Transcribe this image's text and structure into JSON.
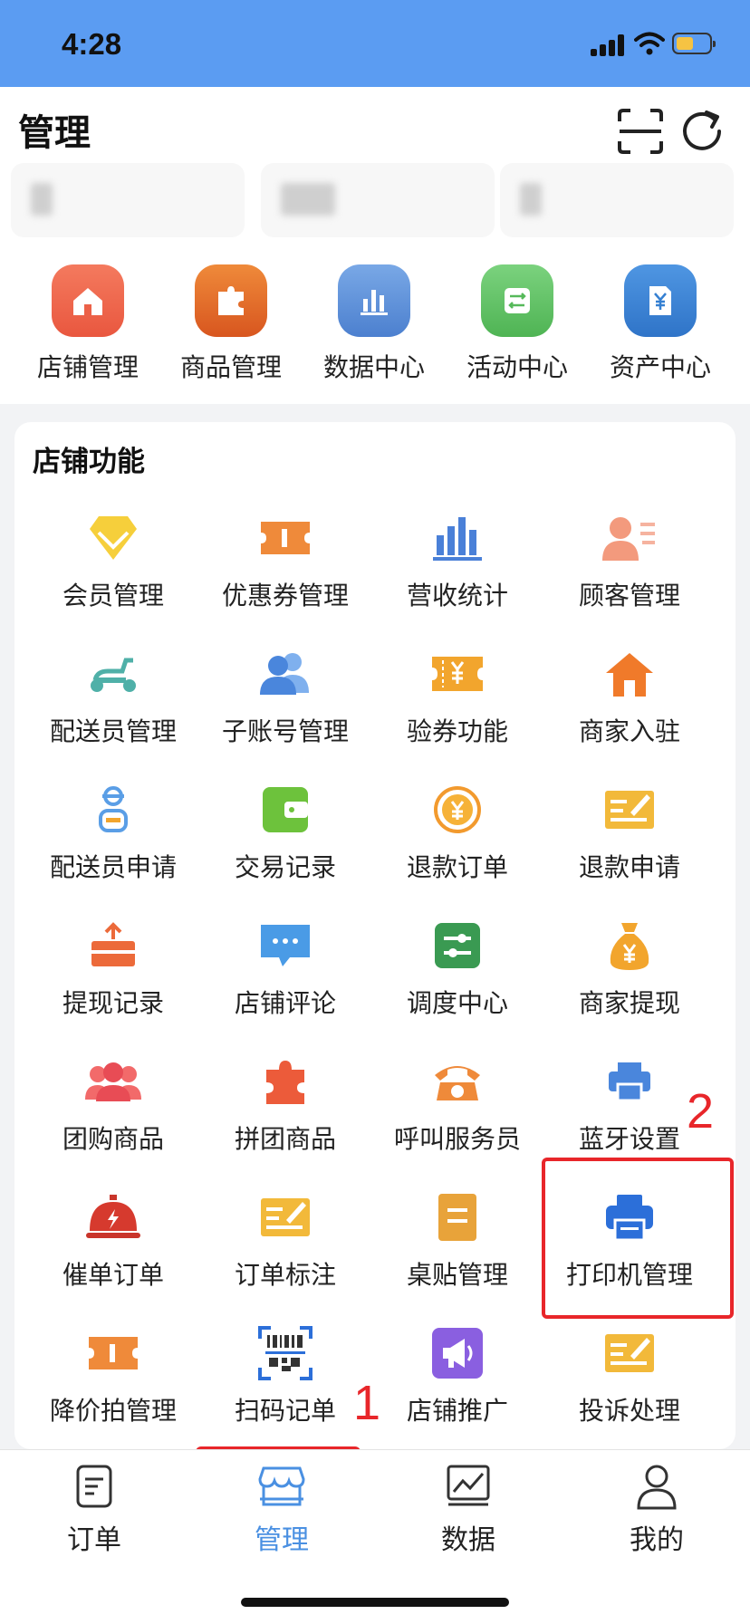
{
  "status_bar": {
    "time": "4:28"
  },
  "header": {
    "title": "管理"
  },
  "quick_menu": [
    {
      "label": "店铺管理",
      "icon": "store-icon",
      "color": "#f0674f"
    },
    {
      "label": "商品管理",
      "icon": "puzzle-icon",
      "color": "#e0682a"
    },
    {
      "label": "数据中心",
      "icon": "bar-chart-icon",
      "color": "#5a8ed8"
    },
    {
      "label": "活动中心",
      "icon": "activity-icon",
      "color": "#63c466"
    },
    {
      "label": "资产中心",
      "icon": "yuan-doc-icon",
      "color": "#3e86d6"
    }
  ],
  "functions": {
    "title": "店铺功能",
    "items": [
      {
        "label": "会员管理",
        "icon": "diamond-icon"
      },
      {
        "label": "优惠券管理",
        "icon": "coupon-icon"
      },
      {
        "label": "营收统计",
        "icon": "bar-chart-icon"
      },
      {
        "label": "顾客管理",
        "icon": "customer-icon"
      },
      {
        "label": "配送员管理",
        "icon": "scooter-icon"
      },
      {
        "label": "子账号管理",
        "icon": "users-icon"
      },
      {
        "label": "验券功能",
        "icon": "ticket-yuan-icon"
      },
      {
        "label": "商家入驻",
        "icon": "house-icon"
      },
      {
        "label": "配送员申请",
        "icon": "courier-icon"
      },
      {
        "label": "交易记录",
        "icon": "wallet-icon"
      },
      {
        "label": "退款订单",
        "icon": "refund-coin-icon"
      },
      {
        "label": "退款申请",
        "icon": "refund-form-icon"
      },
      {
        "label": "提现记录",
        "icon": "withdraw-box-icon"
      },
      {
        "label": "店铺评论",
        "icon": "comment-icon"
      },
      {
        "label": "调度中心",
        "icon": "dispatch-icon"
      },
      {
        "label": "商家提现",
        "icon": "money-bag-icon"
      },
      {
        "label": "团购商品",
        "icon": "group-icon"
      },
      {
        "label": "拼团商品",
        "icon": "puzzle-piece-icon"
      },
      {
        "label": "呼叫服务员",
        "icon": "phone-icon"
      },
      {
        "label": "蓝牙设置",
        "icon": "bluetooth-printer-icon"
      },
      {
        "label": "催单订单",
        "icon": "bell-dish-icon"
      },
      {
        "label": "订单标注",
        "icon": "order-mark-icon"
      },
      {
        "label": "桌贴管理",
        "icon": "table-sticker-icon"
      },
      {
        "label": "打印机管理",
        "icon": "printer-icon"
      },
      {
        "label": "降价拍管理",
        "icon": "price-drop-icon"
      },
      {
        "label": "扫码记单",
        "icon": "qr-scan-icon"
      },
      {
        "label": "店铺推广",
        "icon": "megaphone-icon"
      },
      {
        "label": "投诉处理",
        "icon": "complaint-icon"
      }
    ]
  },
  "annotations": {
    "label_1": "1",
    "label_2": "2"
  },
  "tabbar": [
    {
      "label": "订单",
      "icon": "order-icon"
    },
    {
      "label": "管理",
      "icon": "manage-store-icon",
      "active": true
    },
    {
      "label": "数据",
      "icon": "data-chart-icon"
    },
    {
      "label": "我的",
      "icon": "profile-icon"
    }
  ],
  "colors": {
    "status_bar": "#5b9cf2",
    "active_tab": "#4a90e2",
    "annotation_red": "#e8262a"
  }
}
